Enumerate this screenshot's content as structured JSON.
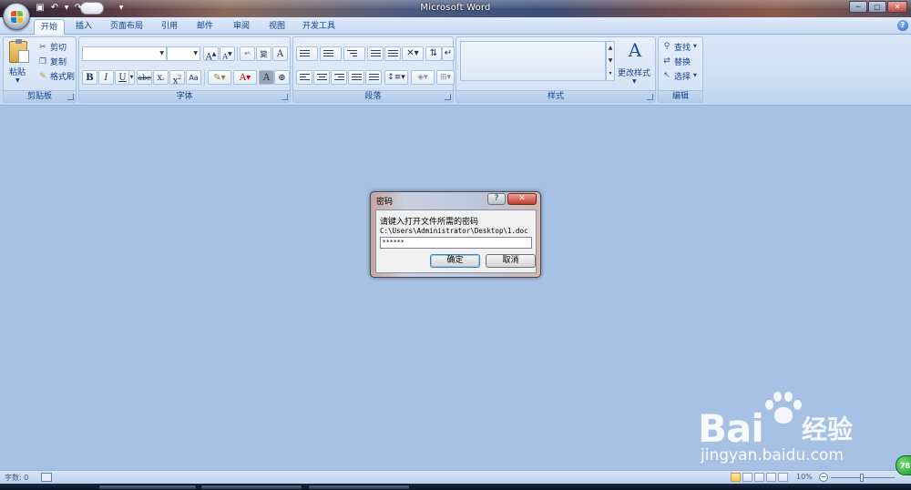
{
  "window": {
    "title": "Microsoft Word",
    "controls": {
      "minimize": "─",
      "maximize": "□",
      "close": "✕"
    }
  },
  "quick_access": [
    "save-icon",
    "undo-icon",
    "redo-icon",
    "print-preview-icon",
    "customize-qat-icon"
  ],
  "tabs": [
    "开始",
    "插入",
    "页面布局",
    "引用",
    "邮件",
    "审阅",
    "视图",
    "开发工具"
  ],
  "active_tab": "开始",
  "help": "?",
  "ribbon": {
    "clipboard": {
      "label": "剪贴板",
      "paste": "粘贴",
      "cut": "剪切",
      "copy": "复制",
      "format_painter": "格式刷"
    },
    "font": {
      "label": "字体",
      "font_name": "",
      "font_size": "",
      "grow": "A",
      "shrink": "A",
      "bold": "B",
      "italic": "I",
      "underline": "U",
      "strikethrough": "abe",
      "subscript": "x",
      "superscript": "x",
      "change_case": "Aa",
      "char_shading": "A"
    },
    "paragraph": {
      "label": "段落"
    },
    "styles": {
      "label": "样式",
      "change_styles": "更改样式"
    },
    "editing": {
      "label": "编辑",
      "find": "查找",
      "replace": "替换",
      "select": "选择"
    }
  },
  "dialog": {
    "title": "密码",
    "help_button": "?",
    "close_button": "✕",
    "prompt": "请键入打开文件所需的密码",
    "path": "C:\\Users\\Administrator\\Desktop\\1.doc",
    "password_value": "******",
    "ok_label": "确定",
    "cancel_label": "取消"
  },
  "watermark": {
    "brand": "Bai",
    "brand_suffix": "经验",
    "url": "jingyan.baidu.com"
  },
  "statusbar": {
    "word_count": "字数: 0",
    "zoom": "10%",
    "badge": "78"
  },
  "colors": {
    "doc_background": "#a7c1e4",
    "ribbon": "#d6e4f6",
    "accent": "#15428b"
  }
}
